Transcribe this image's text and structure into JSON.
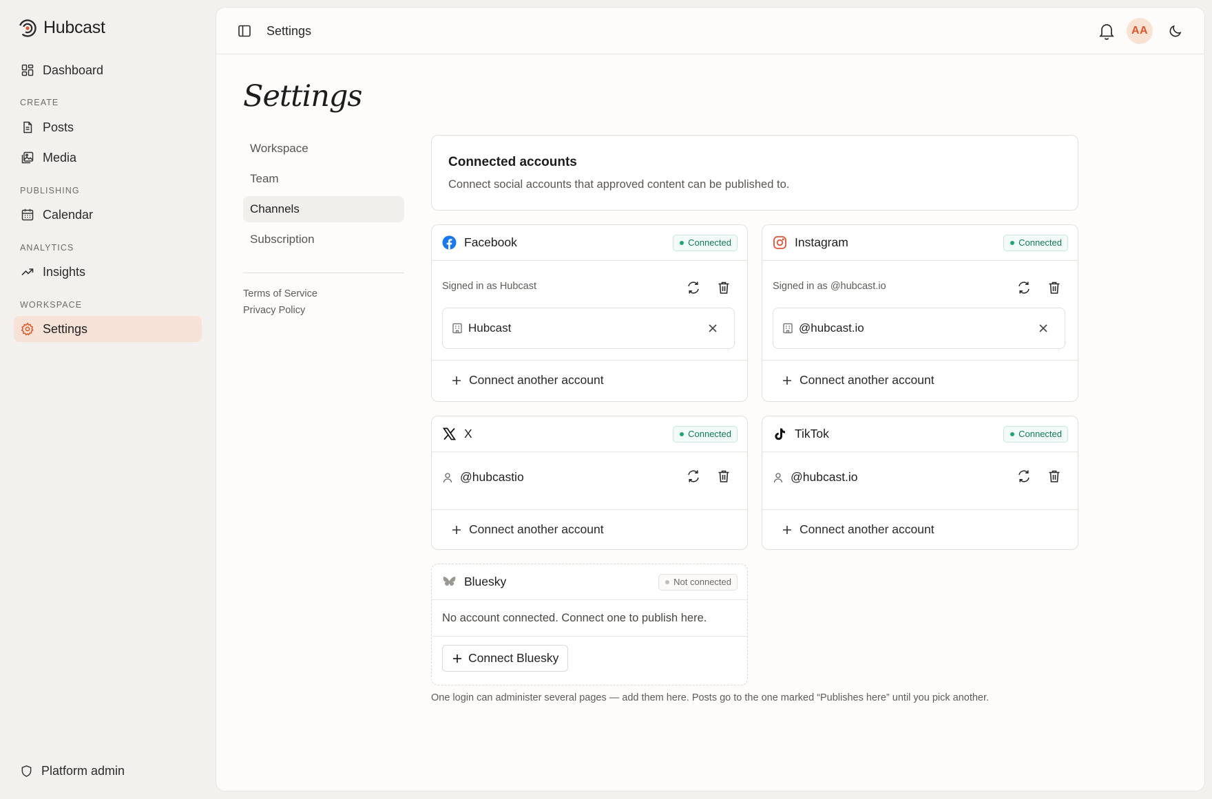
{
  "brand": {
    "name": "Hubcast"
  },
  "sidebar": {
    "dashboard": "Dashboard",
    "sections": {
      "create": "CREATE",
      "publishing": "PUBLISHING",
      "analytics": "ANALYTICS",
      "workspace": "WORKSPACE"
    },
    "posts": "Posts",
    "media": "Media",
    "calendar": "Calendar",
    "insights": "Insights",
    "settings": "Settings",
    "platform_admin": "Platform admin"
  },
  "topbar": {
    "breadcrumb": "Settings",
    "avatar_initials": "AA"
  },
  "page": {
    "title": "Settings"
  },
  "subnav": {
    "items": [
      "Workspace",
      "Team",
      "Channels",
      "Subscription"
    ],
    "active": "Channels",
    "terms": "Terms of Service",
    "privacy": "Privacy Policy"
  },
  "intro": {
    "heading": "Connected accounts",
    "description": "Connect social accounts that approved content can be published to."
  },
  "channels": {
    "facebook": {
      "name": "Facebook",
      "status": "Connected",
      "signed_in": "Signed in as Hubcast",
      "page": "Hubcast",
      "connect_more": "Connect another account"
    },
    "instagram": {
      "name": "Instagram",
      "status": "Connected",
      "signed_in": "Signed in as @hubcast.io",
      "page": "@hubcast.io",
      "connect_more": "Connect another account"
    },
    "x": {
      "name": "X",
      "status": "Connected",
      "account": "@hubcastio",
      "connect_more": "Connect another account"
    },
    "tiktok": {
      "name": "TikTok",
      "status": "Connected",
      "account": "@hubcast.io",
      "connect_more": "Connect another account"
    },
    "bluesky": {
      "name": "Bluesky",
      "status": "Not connected",
      "empty": "No account connected. Connect one to publish here.",
      "button": "Connect Bluesky"
    }
  },
  "footnote": "One login can administer several pages — add them here. Posts go to the one marked “Publishes here” until you pick another.",
  "colors": {
    "accent": "#d9572a",
    "connected": "#1ea672",
    "active_nav_bg": "#f6e2d7"
  }
}
